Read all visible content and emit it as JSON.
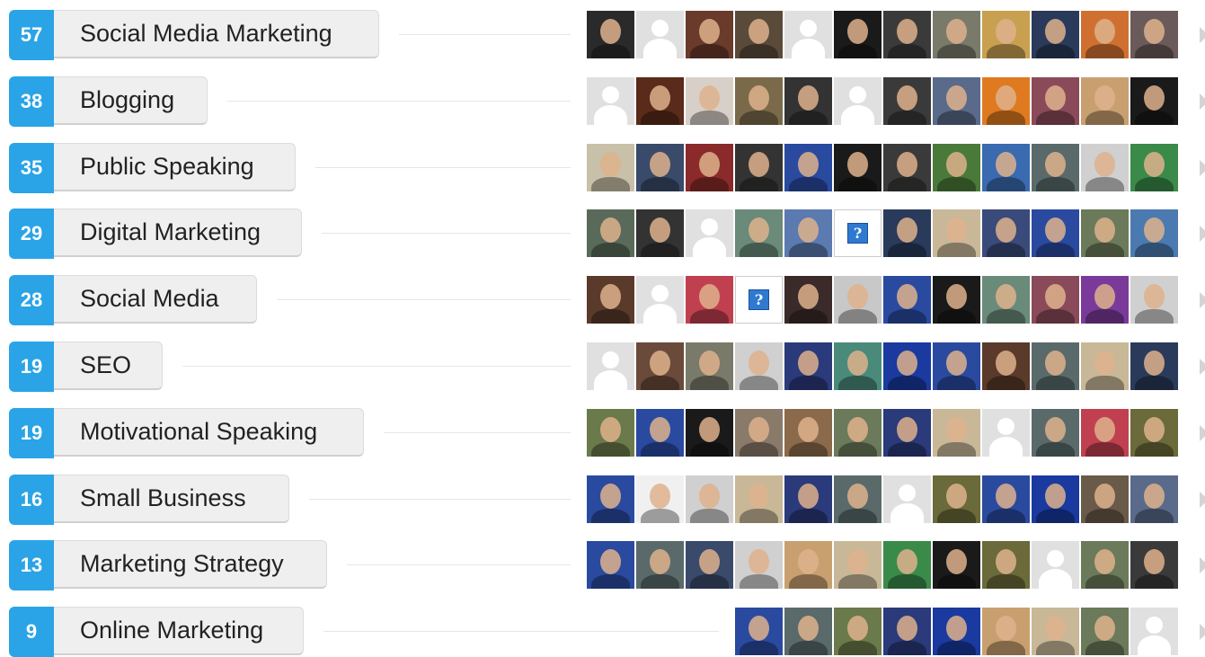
{
  "skills": [
    {
      "count": "57",
      "name": "Social Media Marketing",
      "avatars": [
        "photo:#2a2a2a",
        "placeholder",
        "photo:#6a3a2a",
        "photo:#5a4a3a",
        "placeholder",
        "photo:#1a1a1a",
        "photo:#3a3a3a",
        "photo:#7a7a6a",
        "photo:#c8a050",
        "photo:#2a3a5a",
        "photo:#d07030",
        "photo:#6a5a5a"
      ]
    },
    {
      "count": "38",
      "name": "Blogging",
      "avatars": [
        "placeholder",
        "photo:#5a2a1a",
        "photo:#d8d0c8",
        "photo:#7a6a4a",
        "photo:#333333",
        "placeholder",
        "photo:#3a3a3a",
        "photo:#5a6a8a",
        "photo:#e07a20",
        "photo:#8a4a5a",
        "photo:#c8a070",
        "photo:#1a1a1a"
      ]
    },
    {
      "count": "35",
      "name": "Public Speaking",
      "avatars": [
        "photo:#c8c0a8",
        "photo:#3a4a6a",
        "photo:#8a2a2a",
        "photo:#333333",
        "photo:#2a4aa0",
        "photo:#1a1a1a",
        "photo:#3a3a3a",
        "photo:#4a7a3a",
        "photo:#3a6ab0",
        "photo:#5a6a6a",
        "photo:#d0d0d0",
        "photo:#3a8a4a"
      ]
    },
    {
      "count": "29",
      "name": "Digital Marketing",
      "avatars": [
        "photo:#5a6a5a",
        "photo:#333333",
        "placeholder",
        "photo:#6a8a7a",
        "photo:#5a7ab0",
        "question",
        "photo:#2a3a5a",
        "photo:#c8b898",
        "photo:#3a4a7a",
        "photo:#2a4aa0",
        "photo:#6a7a5a",
        "photo:#4a7ab0"
      ]
    },
    {
      "count": "28",
      "name": "Social Media",
      "avatars": [
        "photo:#5a3a2a",
        "placeholder",
        "photo:#c04050",
        "question",
        "photo:#3a2a2a",
        "photo:#c8c8c8",
        "photo:#2a4aa0",
        "photo:#1a1a1a",
        "photo:#6a8a7a",
        "photo:#8a4a5a",
        "photo:#7a3a9a",
        "photo:#d0d0d0"
      ]
    },
    {
      "count": "19",
      "name": "SEO",
      "avatars": [
        "placeholder",
        "photo:#6a4a3a",
        "photo:#7a7a6a",
        "photo:#d0d0d0",
        "photo:#2a3a7a",
        "photo:#4a8a7a",
        "photo:#1a3aa0",
        "photo:#2a4aa0",
        "photo:#5a3a2a",
        "photo:#5a6a6a",
        "photo:#c8b898",
        "photo:#2a3a5a"
      ]
    },
    {
      "count": "19",
      "name": "Motivational Speaking",
      "avatars": [
        "photo:#6a7a4a",
        "photo:#2a4aa0",
        "photo:#1a1a1a",
        "photo:#8a7a6a",
        "photo:#8a6a4a",
        "photo:#6a7a5a",
        "photo:#2a3a7a",
        "photo:#c8b898",
        "placeholder",
        "photo:#5a6a6a",
        "photo:#c04050",
        "photo:#6a6a3a"
      ]
    },
    {
      "count": "16",
      "name": "Small Business",
      "avatars": [
        "photo:#2a4aa0",
        "photo:#f0f0f0",
        "photo:#d0d0d0",
        "photo:#c8b898",
        "photo:#2a3a7a",
        "photo:#5a6a6a",
        "placeholder",
        "photo:#6a6a3a",
        "photo:#2a4aa0",
        "photo:#1a3aa0",
        "photo:#6a5a4a",
        "photo:#5a6a8a"
      ]
    },
    {
      "count": "13",
      "name": "Marketing Strategy",
      "avatars": [
        "photo:#2a4aa0",
        "photo:#5a6a6a",
        "photo:#3a4a6a",
        "photo:#d0d0d0",
        "photo:#c8a070",
        "photo:#c8b898",
        "photo:#3a8a4a",
        "photo:#1a1a1a",
        "photo:#6a6a3a",
        "placeholder",
        "photo:#6a7a5a",
        "photo:#3a3a3a"
      ]
    },
    {
      "count": "9",
      "name": "Online Marketing",
      "avatars": [
        "photo:#2a4aa0",
        "photo:#5a6a6a",
        "photo:#6a7a4a",
        "photo:#2a3a7a",
        "photo:#1a3aa0",
        "photo:#c8a070",
        "photo:#c8b898",
        "photo:#6a7a5a",
        "placeholder"
      ]
    }
  ]
}
